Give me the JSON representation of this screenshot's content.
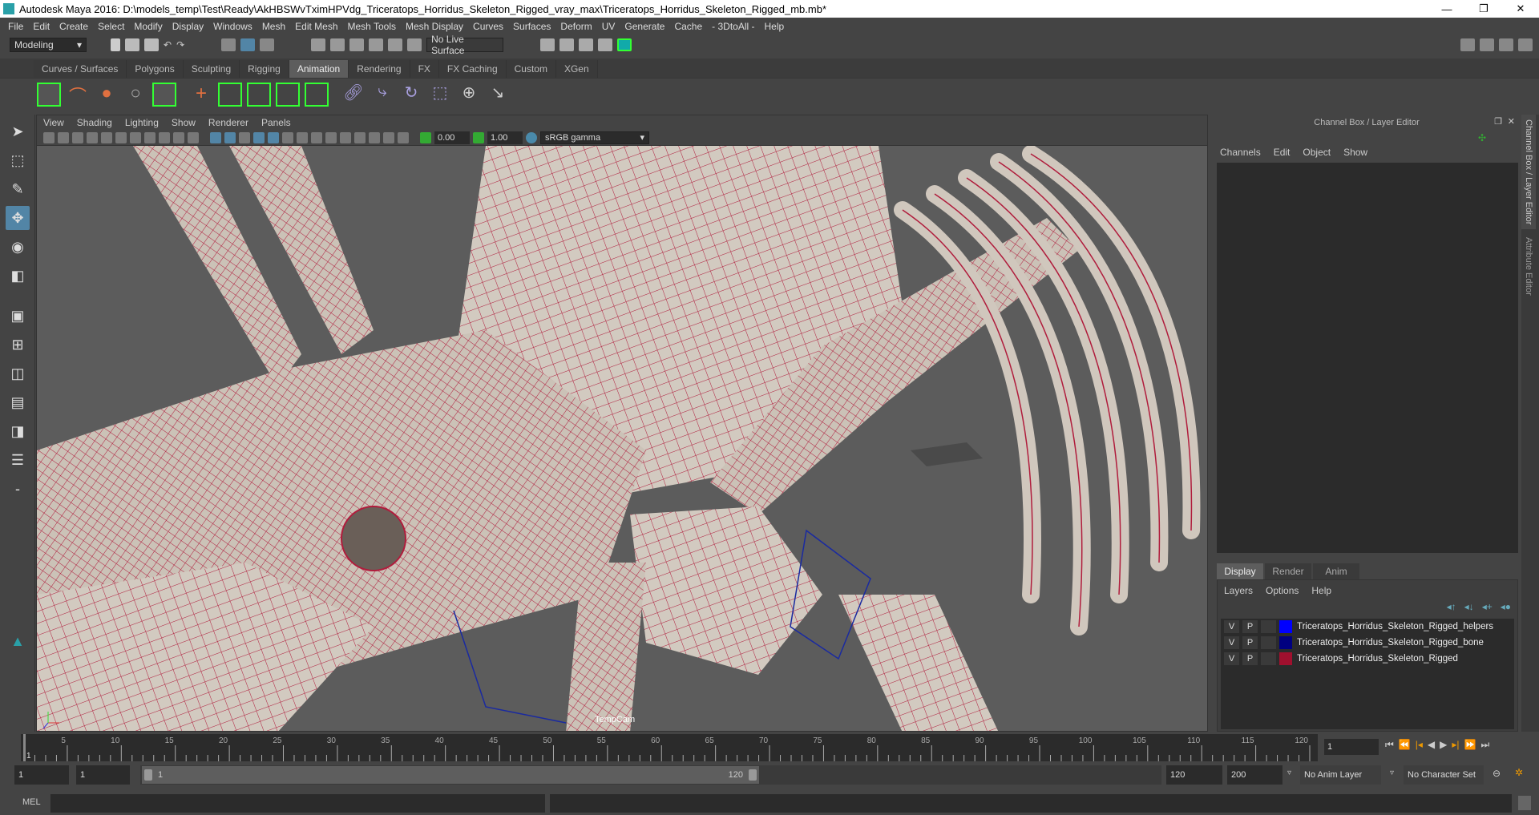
{
  "title": "Autodesk Maya 2016: D:\\models_temp\\Test\\Ready\\AkHBSWvTximHPVdg_Triceratops_Horridus_Skeleton_Rigged_vray_max\\Triceratops_Horridus_Skeleton_Rigged_mb.mb*",
  "menu": [
    "File",
    "Edit",
    "Create",
    "Select",
    "Modify",
    "Display",
    "Windows",
    "Mesh",
    "Edit Mesh",
    "Mesh Tools",
    "Mesh Display",
    "Curves",
    "Surfaces",
    "Deform",
    "UV",
    "Generate",
    "Cache",
    "- 3DtoAll -",
    "Help"
  ],
  "status": {
    "mode": "Modeling",
    "live_surface": "No Live Surface"
  },
  "shelf_tabs": [
    "Curves / Surfaces",
    "Polygons",
    "Sculpting",
    "Rigging",
    "Animation",
    "Rendering",
    "FX",
    "FX Caching",
    "Custom",
    "XGen"
  ],
  "shelf_active": "Animation",
  "viewport": {
    "menu": [
      "View",
      "Shading",
      "Lighting",
      "Show",
      "Renderer",
      "Panels"
    ],
    "exposure": "0.00",
    "gamma": "1.00",
    "color_space": "sRGB gamma",
    "camera": "TempCam"
  },
  "channel_box": {
    "title": "Channel Box / Layer Editor",
    "menu": [
      "Channels",
      "Edit",
      "Object",
      "Show"
    ]
  },
  "layer_editor": {
    "tabs": [
      "Display",
      "Render",
      "Anim"
    ],
    "menu": [
      "Layers",
      "Options",
      "Help"
    ],
    "layers": [
      {
        "v": "V",
        "p": "P",
        "color": "#0000ff",
        "name": "Triceratops_Horridus_Skeleton_Rigged_helpers"
      },
      {
        "v": "V",
        "p": "P",
        "color": "#000080",
        "name": "Triceratops_Horridus_Skeleton_Rigged_bone"
      },
      {
        "v": "V",
        "p": "P",
        "color": "#a0102e",
        "name": "Triceratops_Horridus_Skeleton_Rigged"
      }
    ]
  },
  "side_tabs": [
    "Channel Box / Layer Editor",
    "Attribute Editor"
  ],
  "timeline": {
    "start": 1,
    "end": 120,
    "labels": [
      "5",
      "10",
      "15",
      "20",
      "25",
      "30",
      "35",
      "40",
      "45",
      "50",
      "55",
      "60",
      "65",
      "70",
      "75",
      "80",
      "85",
      "90",
      "95",
      "100",
      "105",
      "110",
      "115",
      "120"
    ],
    "current_frame": "1"
  },
  "range": {
    "start": "1",
    "playback_start": "1",
    "slider_start": "1",
    "slider_end": "120",
    "playback_end": "120",
    "end": "200",
    "anim_layer": "No Anim Layer",
    "character_set": "No Character Set"
  },
  "mel": {
    "label": "MEL"
  }
}
